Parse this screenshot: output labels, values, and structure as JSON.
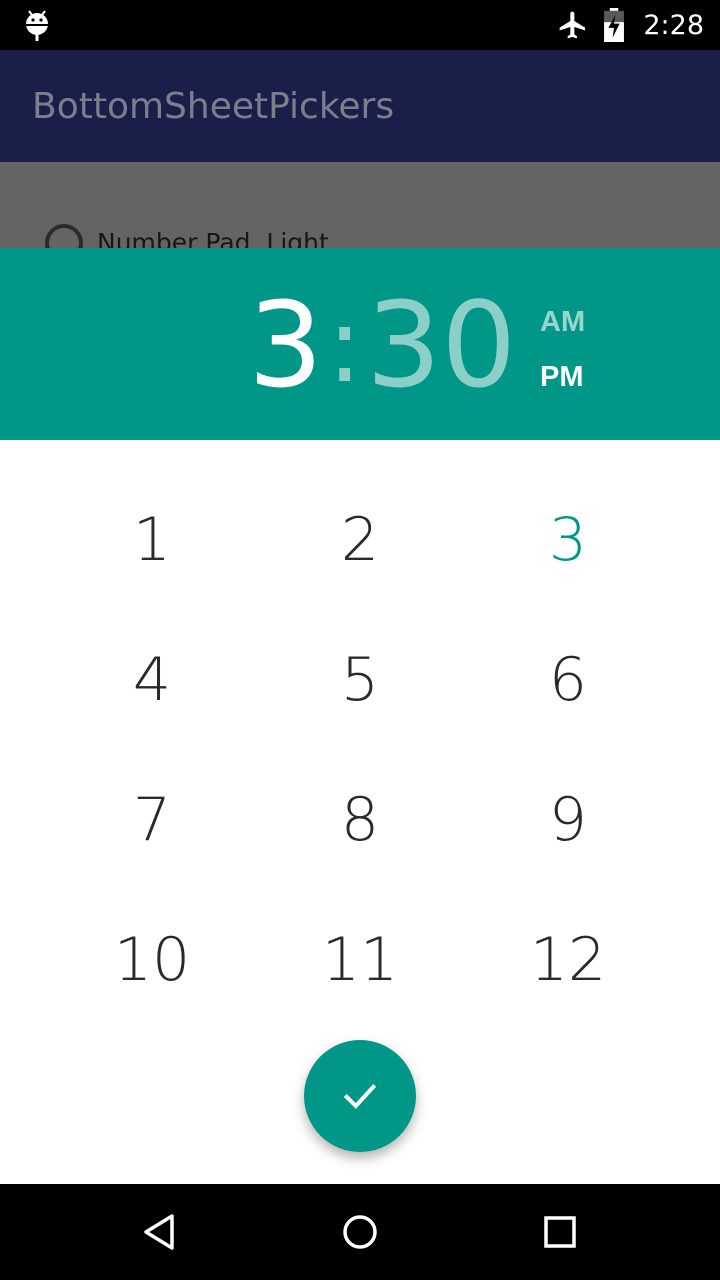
{
  "status_bar": {
    "time": "2:28",
    "icons": [
      "android-debug-icon",
      "airplane-mode-icon",
      "battery-charging-icon"
    ]
  },
  "toolbar": {
    "title": "BottomSheetPickers"
  },
  "background_content": {
    "option_label": "Number Pad, Light"
  },
  "picker": {
    "hour": "3",
    "separator": ":",
    "minute": "30",
    "am_label": "AM",
    "pm_label": "PM",
    "selected_period": "PM",
    "keys": [
      "1",
      "2",
      "3",
      "4",
      "5",
      "6",
      "7",
      "8",
      "9",
      "10",
      "11",
      "12"
    ],
    "highlighted_key": "3",
    "confirm_icon": "check-icon"
  },
  "nav_bar": {
    "icons": [
      "back-icon",
      "home-icon",
      "recents-icon"
    ]
  },
  "colors": {
    "accent": "#009688",
    "toolbar": "#1a1f4a",
    "scrim": "#646464"
  }
}
